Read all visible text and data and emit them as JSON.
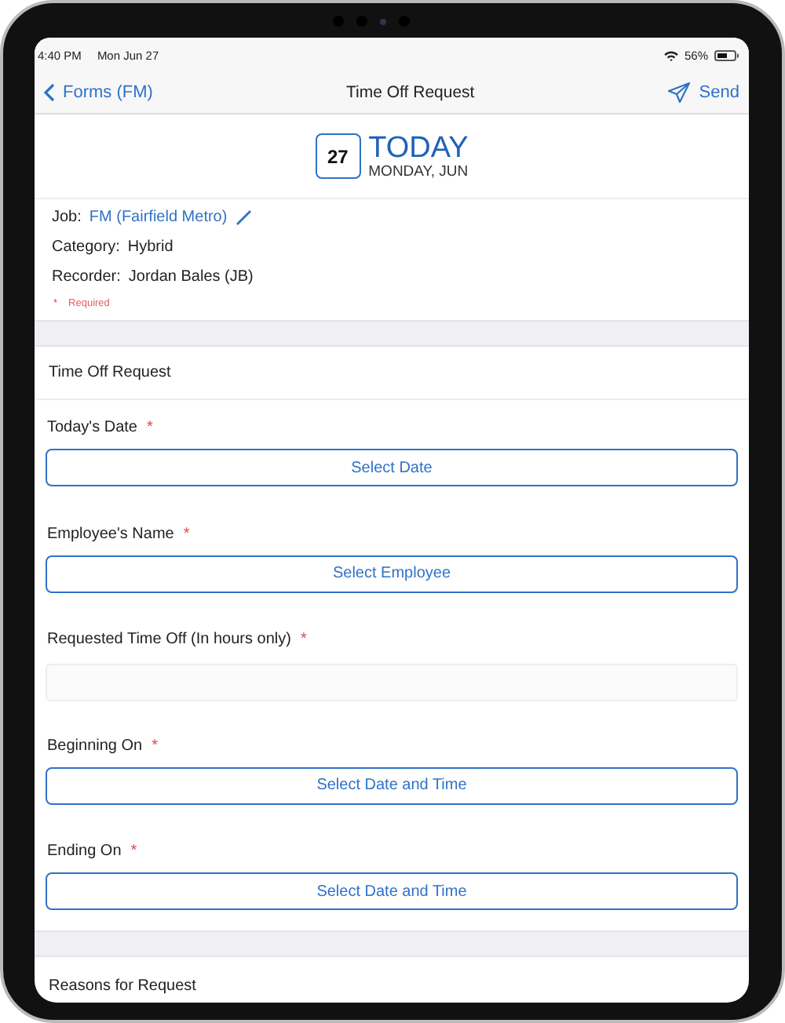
{
  "status_bar": {
    "time": "4:40 PM",
    "date": "Mon Jun 27",
    "battery": "56%"
  },
  "nav": {
    "back": "Forms (FM)",
    "title": "Time Off Request",
    "action": "Send"
  },
  "date_header": {
    "day": "27",
    "title": "TODAY",
    "subtitle": "MONDAY, JUN"
  },
  "info": [
    {
      "label": "Job:",
      "value": "FM (Fairfield Metro)",
      "kind": "link"
    },
    {
      "label": "Category:",
      "value": "Hybrid",
      "kind": "text"
    },
    {
      "label": "Recorder:",
      "value": "Jordan Bales (JB)",
      "kind": "text"
    }
  ],
  "required_note": {
    "mark": "*",
    "text": "Required"
  },
  "section": "Time Off Request",
  "fields": [
    {
      "label": "Today's Date",
      "mark": "*",
      "kind": "button",
      "button": "Select Date"
    },
    {
      "label": "Employee's Name",
      "mark": "*",
      "kind": "button",
      "button": "Select Employee"
    },
    {
      "label": "Requested Time Off (In hours only)",
      "mark": "*",
      "kind": "input"
    },
    {
      "label": "Beginning On",
      "mark": "*",
      "kind": "button",
      "button": "Select Date and Time"
    },
    {
      "label": "Ending On",
      "mark": "*",
      "kind": "button",
      "button": "Select Date and Time"
    }
  ],
  "next_section": "Reasons for Request"
}
